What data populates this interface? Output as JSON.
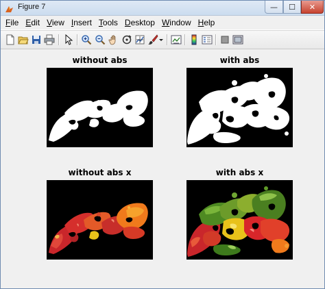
{
  "window": {
    "title": "Figure 7",
    "minimize_label": "—",
    "maximize_label": "☐",
    "close_label": "✕"
  },
  "menu": [
    {
      "key": "F",
      "rest": "ile"
    },
    {
      "key": "E",
      "rest": "dit"
    },
    {
      "key": "V",
      "rest": "iew"
    },
    {
      "key": "I",
      "rest": "nsert"
    },
    {
      "key": "T",
      "rest": "ools"
    },
    {
      "key": "D",
      "rest": "esktop"
    },
    {
      "key": "W",
      "rest": "indow"
    },
    {
      "key": "H",
      "rest": "elp"
    }
  ],
  "toolbar_icons": [
    "new-figure-icon",
    "open-file-icon",
    "save-icon",
    "print-icon",
    "pointer-icon",
    "zoom-in-icon",
    "zoom-out-icon",
    "pan-icon",
    "rotate-3d-icon",
    "data-cursor-icon",
    "brush-icon",
    "brush-dropdown-icon",
    "link-plot-icon",
    "insert-colorbar-icon",
    "insert-legend-icon",
    "hide-plot-tools-icon",
    "show-plot-tools-icon"
  ],
  "plots": {
    "p1": {
      "title": "without abs"
    },
    "p2": {
      "title": "with abs"
    },
    "p3": {
      "title": "without abs x"
    },
    "p4": {
      "title": "with abs x"
    }
  },
  "colors": {
    "figure_bg": "#f0f0f0",
    "axes_bg": "#000000",
    "pepper_red": "#d8262a",
    "pepper_orange": "#f07a1c",
    "pepper_yellow": "#e8c21a",
    "pepper_green": "#4e8a22"
  }
}
